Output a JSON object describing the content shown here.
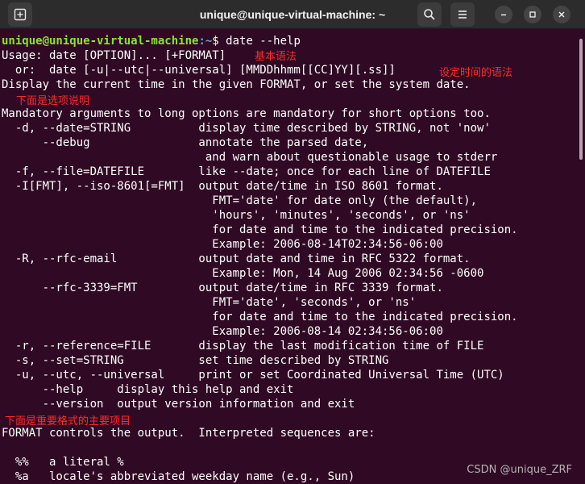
{
  "window": {
    "title": "unique@unique-virtual-machine: ~"
  },
  "titlebar_icons": {
    "new_tab": "new-tab-icon",
    "search": "search-icon",
    "menu": "hamburger-menu-icon",
    "minimize": "minimize-icon",
    "maximize": "maximize-icon",
    "close": "close-icon"
  },
  "prompt": {
    "user_host": "unique@unique-virtual-machine",
    "path": ":~",
    "symbol": "$ ",
    "command": "date --help"
  },
  "output_lines": [
    "Usage: date [OPTION]... [+FORMAT]",
    "  or:  date [-u|--utc|--universal] [MMDDhhmm[[CC]YY][.ss]]",
    "Display the current time in the given FORMAT, or set the system date.",
    "",
    "Mandatory arguments to long options are mandatory for short options too.",
    "  -d, --date=STRING          display time described by STRING, not 'now'",
    "      --debug                annotate the parsed date,",
    "                              and warn about questionable usage to stderr",
    "  -f, --file=DATEFILE        like --date; once for each line of DATEFILE",
    "  -I[FMT], --iso-8601[=FMT]  output date/time in ISO 8601 format.",
    "                               FMT='date' for date only (the default),",
    "                               'hours', 'minutes', 'seconds', or 'ns'",
    "                               for date and time to the indicated precision.",
    "                               Example: 2006-08-14T02:34:56-06:00",
    "  -R, --rfc-email            output date and time in RFC 5322 format.",
    "                               Example: Mon, 14 Aug 2006 02:34:56 -0600",
    "      --rfc-3339=FMT         output date/time in RFC 3339 format.",
    "                               FMT='date', 'seconds', or 'ns'",
    "                               for date and time to the indicated precision.",
    "                               Example: 2006-08-14 02:34:56-06:00",
    "  -r, --reference=FILE       display the last modification time of FILE",
    "  -s, --set=STRING           set time described by STRING",
    "  -u, --utc, --universal     print or set Coordinated Universal Time (UTC)",
    "      --help     display this help and exit",
    "      --version  output version information and exit",
    "",
    "FORMAT controls the output.  Interpreted sequences are:",
    "",
    "  %%   a literal %",
    "  %a   locale's abbreviated weekday name (e.g., Sun)"
  ],
  "annotations": {
    "basic_syntax": "基本语法",
    "set_time_syntax": "设定时间的语法",
    "options_below": "下面是选项说明",
    "formats_below": "下面是重要格式的主要项目"
  },
  "watermark": "CSDN @unique_ZRF",
  "colors": {
    "terminal_bg": "#300a24",
    "prompt_user": "#8ae234",
    "prompt_path": "#729fcf",
    "annotation": "#ff2a2a"
  }
}
